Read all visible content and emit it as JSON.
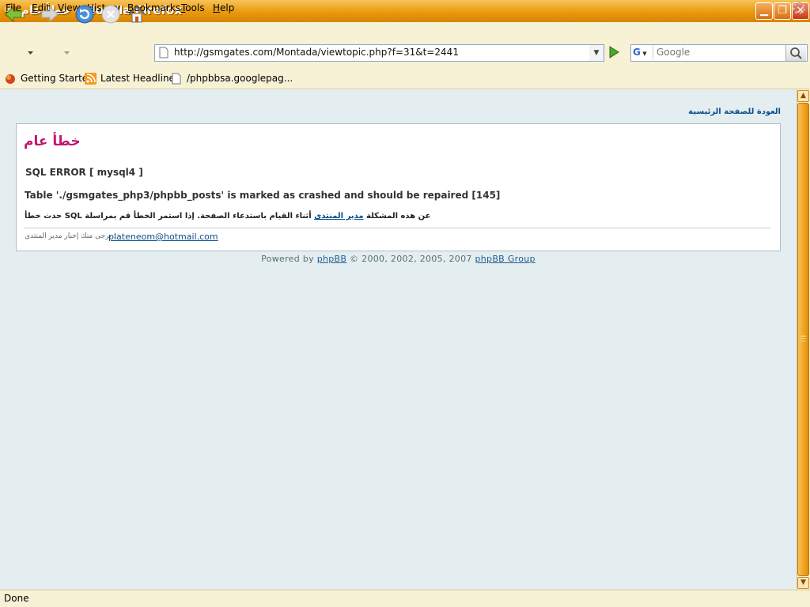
{
  "window": {
    "title": "خطأ عام - Mozilla Firefox"
  },
  "menu": {
    "items": [
      {
        "label": "File",
        "key": "F",
        "rest": "ile"
      },
      {
        "label": "Edit",
        "key": "E",
        "rest": "dit"
      },
      {
        "label": "View",
        "key": "V",
        "rest": "iew"
      },
      {
        "label": "History",
        "key": "H",
        "rest": "istory",
        "pre": "Hi"
      },
      {
        "label": "Bookmarks",
        "key": "B",
        "rest": "ookmarks"
      },
      {
        "label": "Tools",
        "key": "T",
        "rest": "ools"
      },
      {
        "label": "Help",
        "key": "H",
        "rest": "elp"
      }
    ]
  },
  "nav": {
    "url": "http://gsmgates.com/Montada/viewtopic.php?f=31&t=2441",
    "search_engine": "G",
    "search_placeholder": "Google"
  },
  "bookmarks": {
    "items": [
      {
        "label": "Getting Started",
        "icon": "firefox-icon"
      },
      {
        "label": "Latest Headlines",
        "icon": "rss-icon"
      },
      {
        "label": "/phpbbsa.googlepag...",
        "icon": "page-icon"
      }
    ]
  },
  "content": {
    "home_link": "العودة للصفحة الرئيسية",
    "error_title": "خطأ عام",
    "sql_error": "SQL ERROR [ mysql4 ]",
    "table_message": "Table './gsmgates_php3/phpbb_posts' is marked as crashed and should be repaired [145]",
    "arabic_message_pre": "حدث خطأ SQL عن هذه المشكلة ",
    "arabic_message_link": "مدير المنتدى",
    "arabic_message_post": " أثناء القيام باستدعاء الصفحة. إذا استمر الخطأ قم بمراسلة",
    "contact_label": "يرجى منك إخبار مدير المنتدى :",
    "contact_email": "plateneom@hotmail.com",
    "powered_pre": "Powered by ",
    "powered_link1": "phpBB",
    "powered_mid": " © 2000, 2002, 2005, 2007 ",
    "powered_link2": "phpBB Group"
  },
  "status": {
    "text": "Done"
  },
  "colors": {
    "error_title": "#c01770",
    "link": "#0b4d8c",
    "page_bg": "#e4eef0"
  }
}
